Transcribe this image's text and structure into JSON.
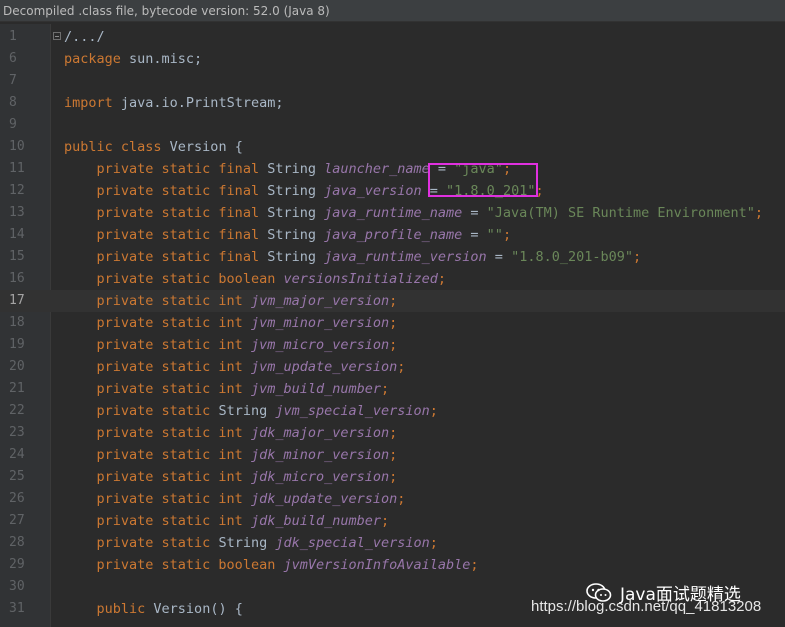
{
  "banner": {
    "text": "Decompiled .class file, bytecode version: 52.0 (Java 8)"
  },
  "lines": [
    {
      "num": "1",
      "parts": [
        [
          "plain",
          "/.../"
        ]
      ]
    },
    {
      "num": "6",
      "parts": [
        [
          "kw",
          "package "
        ],
        [
          "plain",
          "sun.misc;"
        ]
      ]
    },
    {
      "num": "7",
      "parts": []
    },
    {
      "num": "8",
      "parts": [
        [
          "kw",
          "import "
        ],
        [
          "plain",
          "java.io.PrintStream;"
        ]
      ]
    },
    {
      "num": "9",
      "parts": []
    },
    {
      "num": "10",
      "parts": [
        [
          "kw",
          "public class "
        ],
        [
          "plain",
          "Version {"
        ]
      ]
    },
    {
      "num": "11",
      "parts": [
        [
          "plain",
          "    "
        ],
        [
          "kw",
          "private static final "
        ],
        [
          "plain",
          "String "
        ],
        [
          "fld",
          "launcher_name"
        ],
        [
          "plain",
          " = "
        ],
        [
          "str",
          "\"java\""
        ],
        [
          "kw",
          ";"
        ]
      ]
    },
    {
      "num": "12",
      "parts": [
        [
          "plain",
          "    "
        ],
        [
          "kw",
          "private static final "
        ],
        [
          "plain",
          "String "
        ],
        [
          "fld",
          "java_version"
        ],
        [
          "plain",
          " = "
        ],
        [
          "str",
          "\"1.8.0_201\""
        ],
        [
          "kw",
          ";"
        ]
      ]
    },
    {
      "num": "13",
      "parts": [
        [
          "plain",
          "    "
        ],
        [
          "kw",
          "private static final "
        ],
        [
          "plain",
          "String "
        ],
        [
          "fld",
          "java_runtime_name"
        ],
        [
          "plain",
          " = "
        ],
        [
          "str",
          "\"Java(TM) SE Runtime Environment\""
        ],
        [
          "kw",
          ";"
        ]
      ]
    },
    {
      "num": "14",
      "parts": [
        [
          "plain",
          "    "
        ],
        [
          "kw",
          "private static final "
        ],
        [
          "plain",
          "String "
        ],
        [
          "fld",
          "java_profile_name"
        ],
        [
          "plain",
          " = "
        ],
        [
          "str",
          "\"\""
        ],
        [
          "kw",
          ";"
        ]
      ]
    },
    {
      "num": "15",
      "parts": [
        [
          "plain",
          "    "
        ],
        [
          "kw",
          "private static final "
        ],
        [
          "plain",
          "String "
        ],
        [
          "fld",
          "java_runtime_version"
        ],
        [
          "plain",
          " = "
        ],
        [
          "str",
          "\"1.8.0_201-b09\""
        ],
        [
          "kw",
          ";"
        ]
      ]
    },
    {
      "num": "16",
      "parts": [
        [
          "plain",
          "    "
        ],
        [
          "kw",
          "private static boolean "
        ],
        [
          "fld",
          "versionsInitialized"
        ],
        [
          "kw",
          ";"
        ]
      ]
    },
    {
      "num": "17",
      "parts": [
        [
          "plain",
          "    "
        ],
        [
          "kw",
          "private static int "
        ],
        [
          "fld",
          "jvm_major_version"
        ],
        [
          "kw",
          ";"
        ]
      ]
    },
    {
      "num": "18",
      "parts": [
        [
          "plain",
          "    "
        ],
        [
          "kw",
          "private static int "
        ],
        [
          "fld",
          "jvm_minor_version"
        ],
        [
          "kw",
          ";"
        ]
      ]
    },
    {
      "num": "19",
      "parts": [
        [
          "plain",
          "    "
        ],
        [
          "kw",
          "private static int "
        ],
        [
          "fld",
          "jvm_micro_version"
        ],
        [
          "kw",
          ";"
        ]
      ]
    },
    {
      "num": "20",
      "parts": [
        [
          "plain",
          "    "
        ],
        [
          "kw",
          "private static int "
        ],
        [
          "fld",
          "jvm_update_version"
        ],
        [
          "kw",
          ";"
        ]
      ]
    },
    {
      "num": "21",
      "parts": [
        [
          "plain",
          "    "
        ],
        [
          "kw",
          "private static int "
        ],
        [
          "fld",
          "jvm_build_number"
        ],
        [
          "kw",
          ";"
        ]
      ]
    },
    {
      "num": "22",
      "parts": [
        [
          "plain",
          "    "
        ],
        [
          "kw",
          "private static "
        ],
        [
          "plain",
          "String "
        ],
        [
          "fld",
          "jvm_special_version"
        ],
        [
          "kw",
          ";"
        ]
      ]
    },
    {
      "num": "23",
      "parts": [
        [
          "plain",
          "    "
        ],
        [
          "kw",
          "private static int "
        ],
        [
          "fld",
          "jdk_major_version"
        ],
        [
          "kw",
          ";"
        ]
      ]
    },
    {
      "num": "24",
      "parts": [
        [
          "plain",
          "    "
        ],
        [
          "kw",
          "private static int "
        ],
        [
          "fld",
          "jdk_minor_version"
        ],
        [
          "kw",
          ";"
        ]
      ]
    },
    {
      "num": "25",
      "parts": [
        [
          "plain",
          "    "
        ],
        [
          "kw",
          "private static int "
        ],
        [
          "fld",
          "jdk_micro_version"
        ],
        [
          "kw",
          ";"
        ]
      ]
    },
    {
      "num": "26",
      "parts": [
        [
          "plain",
          "    "
        ],
        [
          "kw",
          "private static int "
        ],
        [
          "fld",
          "jdk_update_version"
        ],
        [
          "kw",
          ";"
        ]
      ]
    },
    {
      "num": "27",
      "parts": [
        [
          "plain",
          "    "
        ],
        [
          "kw",
          "private static int "
        ],
        [
          "fld",
          "jdk_build_number"
        ],
        [
          "kw",
          ";"
        ]
      ]
    },
    {
      "num": "28",
      "parts": [
        [
          "plain",
          "    "
        ],
        [
          "kw",
          "private static "
        ],
        [
          "plain",
          "String "
        ],
        [
          "fld",
          "jdk_special_version"
        ],
        [
          "kw",
          ";"
        ]
      ]
    },
    {
      "num": "29",
      "parts": [
        [
          "plain",
          "    "
        ],
        [
          "kw",
          "private static boolean "
        ],
        [
          "fld",
          "jvmVersionInfoAvailable"
        ],
        [
          "kw",
          ";"
        ]
      ]
    },
    {
      "num": "30",
      "parts": []
    },
    {
      "num": "31",
      "parts": [
        [
          "plain",
          "    "
        ],
        [
          "kw",
          "public "
        ],
        [
          "plain",
          "Version() {"
        ]
      ]
    }
  ],
  "current_line": "17",
  "watermark": {
    "title": "Java面试题精选",
    "url": "https://blog.csdn.net/qq_41813208",
    "icon": "wechat-icon"
  },
  "colors": {
    "keyword": "#cc7832",
    "string": "#6a8759",
    "field": "#9876aa",
    "plain": "#a9b7c6",
    "highlight_box": "#e030e0"
  }
}
